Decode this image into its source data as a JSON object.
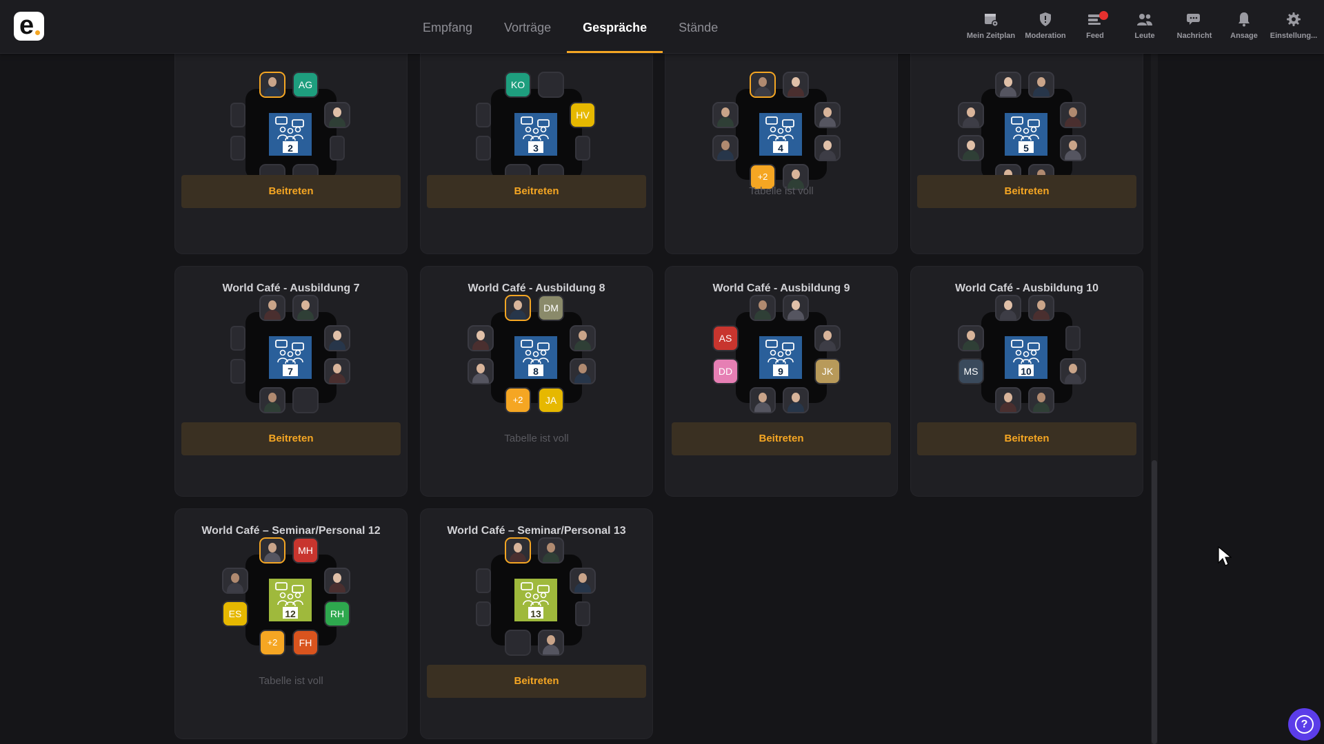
{
  "app": {
    "logo_text": "e"
  },
  "nav": {
    "tabs": [
      {
        "label": "Empfang",
        "active": false
      },
      {
        "label": "Vorträge",
        "active": false
      },
      {
        "label": "Gespräche",
        "active": true
      },
      {
        "label": "Stände",
        "active": false
      }
    ]
  },
  "toolbar": {
    "items": [
      {
        "label": "Mein Zeitplan",
        "icon": "calendar-gear-icon"
      },
      {
        "label": "Moderation",
        "icon": "shield-icon"
      },
      {
        "label": "Feed",
        "icon": "feed-icon",
        "notification": true
      },
      {
        "label": "Leute",
        "icon": "people-icon"
      },
      {
        "label": "Nachricht",
        "icon": "chat-icon"
      },
      {
        "label": "Ansage",
        "icon": "bell-icon"
      },
      {
        "label": "Einstellung...",
        "icon": "gear-icon"
      }
    ]
  },
  "colors": {
    "accent": "#f5a623",
    "table_blue": "#2a5f9a",
    "table_green": "#9fb93c",
    "help": "#5b3de9"
  },
  "labels": {
    "join": "Beitreten",
    "full": "Tabelle ist voll"
  },
  "tables": [
    {
      "title": "",
      "number": "2",
      "full": false,
      "color": "blue"
    },
    {
      "title": "",
      "number": "3",
      "full": false,
      "color": "blue"
    },
    {
      "title": "",
      "number": "4",
      "full": true,
      "color": "blue"
    },
    {
      "title": "",
      "number": "5",
      "full": false,
      "color": "blue"
    },
    {
      "title": "World Café - Ausbildung 7",
      "number": "7",
      "full": false,
      "color": "blue"
    },
    {
      "title": "World Café - Ausbildung 8",
      "number": "8",
      "full": true,
      "color": "blue"
    },
    {
      "title": "World Café - Ausbildung 9",
      "number": "9",
      "full": false,
      "color": "blue"
    },
    {
      "title": "World Café - Ausbildung 10",
      "number": "10",
      "full": false,
      "color": "blue"
    },
    {
      "title": "World Café – Seminar/Personal 12",
      "number": "12",
      "full": true,
      "color": "green"
    },
    {
      "title": "World Café – Seminar/Personal 13",
      "number": "13",
      "full": false,
      "color": "green"
    }
  ],
  "seats": [
    [
      "host",
      "AG",
      "empty",
      "occupied",
      "empty",
      "empty",
      "empty",
      "empty"
    ],
    [
      "KO",
      "empty",
      "empty",
      "HV",
      "empty",
      "empty",
      "empty",
      "empty"
    ],
    [
      "host",
      "occupied",
      "occupied",
      "occupied",
      "occupied",
      "occupied",
      "+2",
      "occupied"
    ],
    [
      "occupied",
      "occupied",
      "occupied",
      "occupied",
      "occupied",
      "occupied",
      "occupied",
      "occupied"
    ],
    [
      "occupied",
      "occupied",
      "empty",
      "occupied",
      "empty",
      "occupied",
      "occupied",
      "empty"
    ],
    [
      "host",
      "DM",
      "occupied",
      "occupied",
      "occupied",
      "occupied",
      "+2",
      "JA"
    ],
    [
      "occupied",
      "occupied",
      "AS",
      "occupied",
      "DD",
      "JK",
      "occupied",
      "occupied"
    ],
    [
      "occupied",
      "occupied",
      "occupied",
      "empty",
      "MS",
      "occupied",
      "occupied",
      "occupied"
    ],
    [
      "host",
      "MH",
      "occupied",
      "occupied",
      "ES",
      "RH",
      "+2",
      "FH"
    ],
    [
      "host",
      "occupied",
      "empty",
      "occupied",
      "empty",
      "empty",
      "empty",
      "occupied"
    ]
  ],
  "initial_colors": {
    "AG": "#1e9e7e",
    "KO": "#1e9e7e",
    "HV": "#e6b800",
    "DM": "#8a8a6a",
    "AS": "#c8352e",
    "DD": "#e67fb4",
    "JK": "#b89a5a",
    "MS": "#3a4a5c",
    "MH": "#c8352e",
    "ES": "#e6b800",
    "RH": "#2ea84e",
    "FH": "#d9541e",
    "JA": "#e6b800"
  }
}
